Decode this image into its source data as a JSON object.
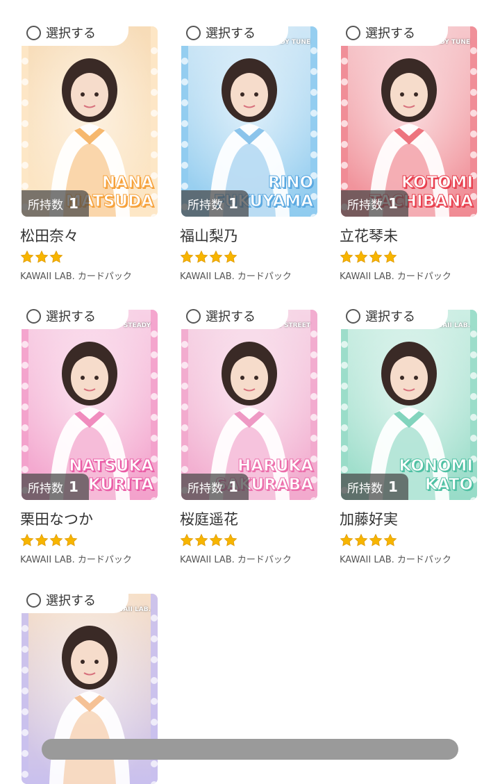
{
  "select_label": "選択する",
  "owned_label": "所持数",
  "cards": [
    {
      "name": "松田奈々",
      "name_en": [
        "NANA",
        "MATSUDA"
      ],
      "stars": 3,
      "pack": "KAWAII LAB. カードパック",
      "owned": "1",
      "brand": "",
      "theme": {
        "bg": "#f7dcb8",
        "accent": "#f4a64a",
        "frame": "#fde7c6",
        "text": "#f6a13a"
      }
    },
    {
      "name": "福山梨乃",
      "name_en": [
        "RINO",
        "FUKUYAMA"
      ],
      "stars": 4,
      "pack": "KAWAII LAB. カードパック",
      "owned": "1",
      "brand": "CANDY TUNE",
      "theme": {
        "bg": "#cfe7f6",
        "accent": "#6fb5e6",
        "frame": "#8fcbef",
        "text": "#5aa8e0"
      }
    },
    {
      "name": "立花琴未",
      "name_en": [
        "KOTOMI",
        "TACHIBANA"
      ],
      "stars": 4,
      "pack": "KAWAII LAB. カードパック",
      "owned": "1",
      "brand": "CANDY TUNE",
      "theme": {
        "bg": "#f6c8cc",
        "accent": "#e8525f",
        "frame": "#f08a93",
        "text": "#e8404f"
      }
    },
    {
      "name": "栗田なつか",
      "name_en": [
        "NATSUKA",
        "KURITA"
      ],
      "stars": 4,
      "pack": "KAWAII LAB. カードパック",
      "owned": "1",
      "brand": "SWEET STEADY",
      "theme": {
        "bg": "#f8d2e6",
        "accent": "#ec6fae",
        "frame": "#f3a1cb",
        "text": "#ea5da6"
      }
    },
    {
      "name": "桜庭遥花",
      "name_en": [
        "HARUKA",
        "SAKURABA"
      ],
      "stars": 4,
      "pack": "KAWAII LAB. カードパック",
      "owned": "1",
      "brand": "CUTIE STREET",
      "theme": {
        "bg": "#f6d6e6",
        "accent": "#ea7fb5",
        "frame": "#f2a9cd",
        "text": "#ec6eab"
      }
    },
    {
      "name": "加藤好実",
      "name_en": [
        "KONOMI",
        "KATO"
      ],
      "stars": 4,
      "pack": "KAWAII LAB. カードパック",
      "owned": "1",
      "brand": "KAWAII LAB.",
      "theme": {
        "bg": "#cdeee4",
        "accent": "#63c9ad",
        "frame": "#98dcc8",
        "text": "#4fc0a3"
      }
    },
    {
      "name": "",
      "name_en": [
        "",
        ""
      ],
      "stars": 0,
      "pack": "",
      "owned": "",
      "brand": "KAWAII LAB.",
      "theme": {
        "bg": "#f7e0c8",
        "accent": "#f2b27a",
        "frame": "#c9c0ee",
        "text": "#f2a060"
      }
    }
  ],
  "icons": {
    "radio": "radio-unchecked-icon",
    "star": "star-icon"
  },
  "colors": {
    "star": "#f7b500",
    "star_edge": "#e09a00",
    "badge_bg": "#464646"
  }
}
